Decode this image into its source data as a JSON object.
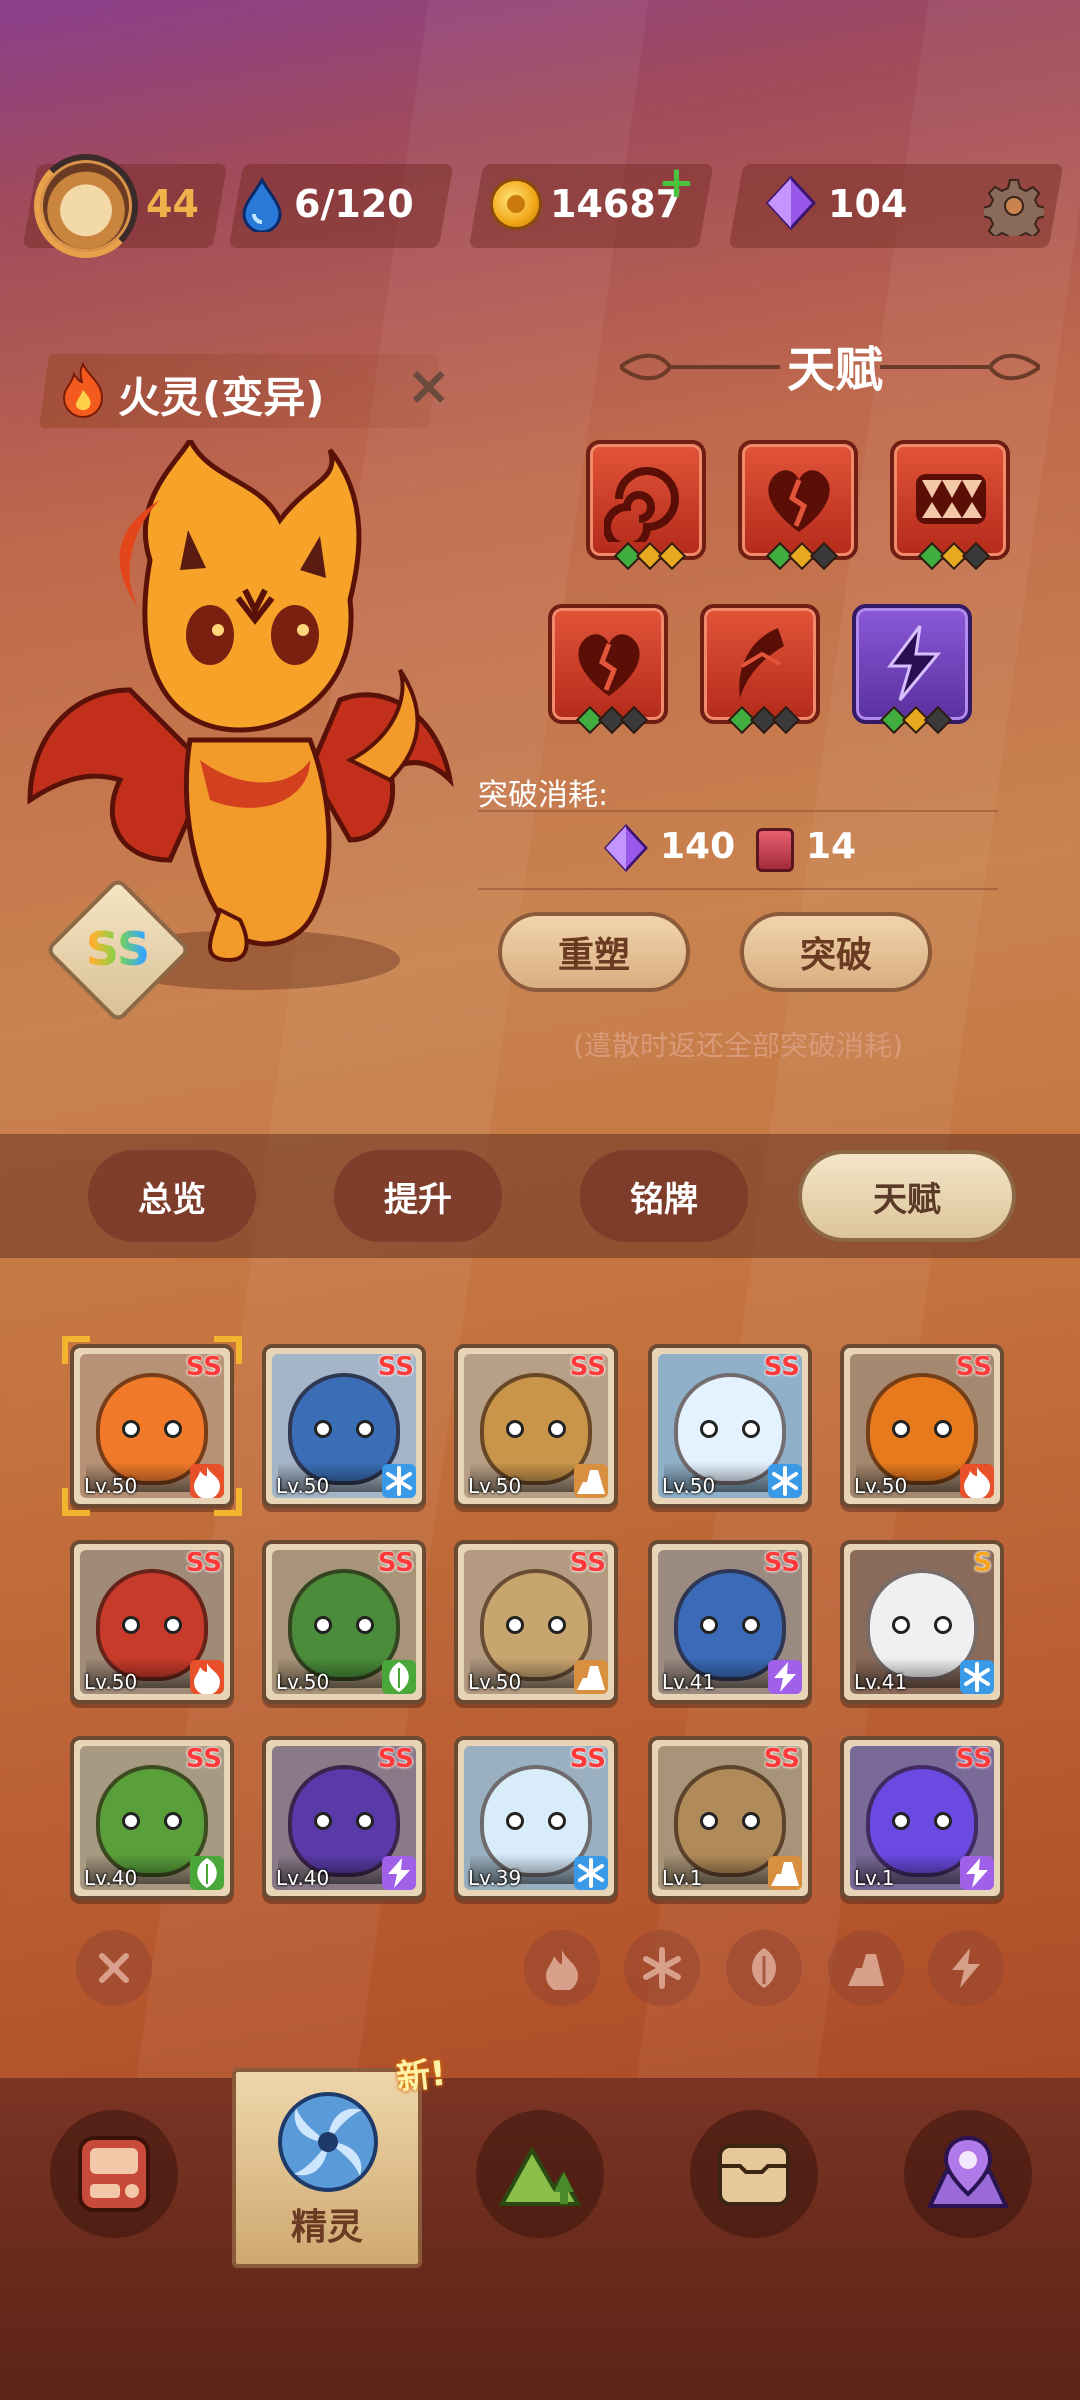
{
  "colors": {
    "accent_red": "#c83a24",
    "gem_purple": "#8a4ee0",
    "coin_gold": "#f2a818",
    "active_tab": "#e8d8b4",
    "plus_green": "#4ac23e"
  },
  "topbar": {
    "level": "44",
    "stamina": "6/120",
    "coins": "14687",
    "gems": "104",
    "icons": [
      "avatar",
      "water-drop-icon",
      "coin-icon",
      "plus-icon",
      "gem-icon",
      "gear-icon"
    ]
  },
  "creature": {
    "name": "火灵(变异)",
    "grade": "SS",
    "element_icon": "fire-icon"
  },
  "talent": {
    "title": "天赋",
    "skills": [
      {
        "icon": "spiral-icon",
        "purple": false,
        "stars": [
          "#3fae3f",
          "#e8a820",
          "#e8a820"
        ]
      },
      {
        "icon": "broken-heart-icon",
        "purple": false,
        "stars": [
          "#3fae3f",
          "#e8a820",
          "#3a3a3a"
        ]
      },
      {
        "icon": "fang-mouth-icon",
        "purple": false,
        "stars": [
          "#3fae3f",
          "#e8a820",
          "#3a3a3a"
        ]
      },
      {
        "icon": "broken-heart-icon",
        "purple": false,
        "stars": [
          "#3fae3f",
          "#3a3a3a",
          "#3a3a3a"
        ]
      },
      {
        "icon": "slash-icon",
        "purple": false,
        "stars": [
          "#3fae3f",
          "#3a3a3a",
          "#3a3a3a"
        ]
      },
      {
        "icon": "lightning-icon",
        "purple": true,
        "stars": [
          "#3fae3f",
          "#e8a820",
          "#3a3a3a"
        ]
      }
    ],
    "cost_label": "突破消耗:",
    "cost_gems": "140",
    "cost_cards": "14",
    "reset_button": "重塑",
    "breakthrough_button": "突破",
    "note": "(遣散时返还全部突破消耗)"
  },
  "tabs": [
    "总览",
    "提升",
    "铭牌",
    "天赋"
  ],
  "active_tab": 3,
  "pets": [
    {
      "level": "Lv.50",
      "rank": "SS",
      "element": "fire",
      "color": "#f07a2a",
      "bg": "#b89276",
      "selected": true
    },
    {
      "level": "Lv.50",
      "rank": "SS",
      "element": "ice",
      "color": "#3a6fb8",
      "bg": "#a5b5c8"
    },
    {
      "level": "Lv.50",
      "rank": "SS",
      "element": "earth",
      "color": "#c9954a",
      "bg": "#b8a088"
    },
    {
      "level": "Lv.50",
      "rank": "SS",
      "element": "ice",
      "color": "#e4f2ff",
      "bg": "#8fb0c8"
    },
    {
      "level": "Lv.50",
      "rank": "SS",
      "element": "fire",
      "color": "#e87a1e",
      "bg": "#a58870"
    },
    {
      "level": "Lv.50",
      "rank": "SS",
      "element": "fire",
      "color": "#c83a2a",
      "bg": "#a08a78"
    },
    {
      "level": "Lv.50",
      "rank": "SS",
      "element": "leaf",
      "color": "#4a8c3a",
      "bg": "#a89478"
    },
    {
      "level": "Lv.50",
      "rank": "SS",
      "element": "earth",
      "color": "#c8a46e",
      "bg": "#b39a80"
    },
    {
      "level": "Lv.41",
      "rank": "SS",
      "element": "thunder",
      "color": "#3a6ab8",
      "bg": "#9a8a80"
    },
    {
      "level": "Lv.41",
      "rank": "S",
      "element": "ice",
      "color": "#f0f0f0",
      "bg": "#8a6a58"
    },
    {
      "level": "Lv.40",
      "rank": "SS",
      "element": "leaf",
      "color": "#5aa03a",
      "bg": "#a89a82"
    },
    {
      "level": "Lv.40",
      "rank": "SS",
      "element": "thunder",
      "color": "#5a3aa8",
      "bg": "#8a7a88"
    },
    {
      "level": "Lv.39",
      "rank": "SS",
      "element": "ice",
      "color": "#d8ecfa",
      "bg": "#9ab0c0"
    },
    {
      "level": "Lv.1",
      "rank": "SS",
      "element": "earth",
      "color": "#b08a58",
      "bg": "#a89478"
    },
    {
      "level": "Lv.1",
      "rank": "SS",
      "element": "thunder",
      "color": "#6a4ae0",
      "bg": "#7a6a98"
    }
  ],
  "element_colors": {
    "fire": "#e8502a",
    "ice": "#3a9ae8",
    "earth": "#d89040",
    "leaf": "#4aa83a",
    "thunder": "#a060e8"
  },
  "filters": [
    "clear-filter-icon",
    "fire-filter-icon",
    "ice-filter-icon",
    "leaf-filter-icon",
    "earth-filter-icon",
    "thunder-filter-icon"
  ],
  "bottom_nav": {
    "items": [
      "machine-icon",
      "spirit-icon",
      "mountain-icon",
      "chest-icon",
      "map-pin-icon"
    ],
    "active_label": "精灵",
    "new_tag": "新!"
  }
}
